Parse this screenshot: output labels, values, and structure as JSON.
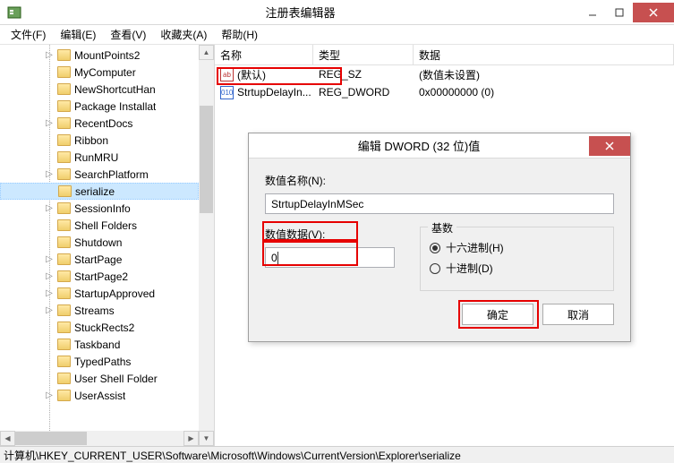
{
  "window": {
    "title": "注册表编辑器"
  },
  "menu": {
    "file": "文件(F)",
    "edit": "编辑(E)",
    "view": "查看(V)",
    "favorites": "收藏夹(A)",
    "help": "帮助(H)"
  },
  "tree": {
    "items": [
      {
        "label": "MountPoints2",
        "expandable": true
      },
      {
        "label": "MyComputer",
        "expandable": false
      },
      {
        "label": "NewShortcutHan",
        "expandable": false
      },
      {
        "label": "Package Installat",
        "expandable": false
      },
      {
        "label": "RecentDocs",
        "expandable": true
      },
      {
        "label": "Ribbon",
        "expandable": false
      },
      {
        "label": "RunMRU",
        "expandable": false
      },
      {
        "label": "SearchPlatform",
        "expandable": true
      },
      {
        "label": "serialize",
        "expandable": false,
        "selected": true
      },
      {
        "label": "SessionInfo",
        "expandable": true
      },
      {
        "label": "Shell Folders",
        "expandable": false
      },
      {
        "label": "Shutdown",
        "expandable": false
      },
      {
        "label": "StartPage",
        "expandable": true
      },
      {
        "label": "StartPage2",
        "expandable": true
      },
      {
        "label": "StartupApproved",
        "expandable": true
      },
      {
        "label": "Streams",
        "expandable": true
      },
      {
        "label": "StuckRects2",
        "expandable": false
      },
      {
        "label": "Taskband",
        "expandable": false
      },
      {
        "label": "TypedPaths",
        "expandable": false
      },
      {
        "label": "User Shell Folder",
        "expandable": false
      },
      {
        "label": "UserAssist",
        "expandable": true
      }
    ]
  },
  "list": {
    "headers": {
      "name": "名称",
      "type": "类型",
      "data": "数据"
    },
    "rows": [
      {
        "name": "(默认)",
        "type": "REG_SZ",
        "data": "(数值未设置)",
        "icon": "sz",
        "iconTxt": "ab"
      },
      {
        "name": "StrtupDelayIn...",
        "type": "REG_DWORD",
        "data": "0x00000000 (0)",
        "icon": "dw",
        "iconTxt": "010"
      }
    ]
  },
  "dialog": {
    "title": "编辑 DWORD (32 位)值",
    "nameLabel": "数值名称(N):",
    "nameValue": "StrtupDelayInMSec",
    "dataLabel": "数值数据(V):",
    "dataValue": "0",
    "baseLabel": "基数",
    "hexLabel": "十六进制(H)",
    "decLabel": "十进制(D)",
    "ok": "确定",
    "cancel": "取消"
  },
  "statusbar": "计算机\\HKEY_CURRENT_USER\\Software\\Microsoft\\Windows\\CurrentVersion\\Explorer\\serialize"
}
